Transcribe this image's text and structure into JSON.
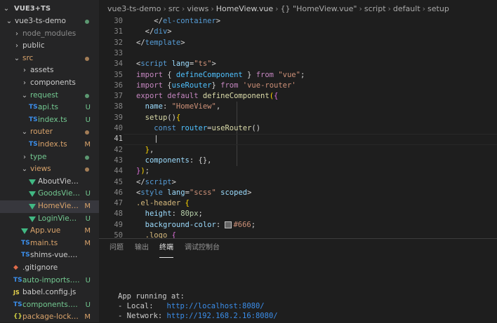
{
  "explorer": {
    "root": "VUE3+TS",
    "items": [
      {
        "label": "vue3-ts-demo",
        "kind": "folder-open",
        "indent": 0,
        "dot": true,
        "color": "#cccccc"
      },
      {
        "label": "node_modules",
        "kind": "folder",
        "indent": 1,
        "color": "#8c8c8c"
      },
      {
        "label": "public",
        "kind": "folder",
        "indent": 1,
        "color": "#cccccc"
      },
      {
        "label": "src",
        "kind": "folder-open",
        "indent": 1,
        "dot": true,
        "color": "#d9a36b"
      },
      {
        "label": "assets",
        "kind": "folder",
        "indent": 2,
        "color": "#cccccc"
      },
      {
        "label": "components",
        "kind": "folder",
        "indent": 2,
        "color": "#cccccc"
      },
      {
        "label": "request",
        "kind": "folder-open",
        "indent": 2,
        "dot": true,
        "color": "#73c991"
      },
      {
        "label": "api.ts",
        "kind": "ts",
        "indent": 3,
        "badge": "U",
        "color": "#73c991"
      },
      {
        "label": "index.ts",
        "kind": "ts",
        "indent": 3,
        "badge": "U",
        "color": "#73c991"
      },
      {
        "label": "router",
        "kind": "folder-open",
        "indent": 2,
        "dot": true,
        "color": "#d9a36b"
      },
      {
        "label": "index.ts",
        "kind": "ts",
        "indent": 3,
        "badge": "M",
        "color": "#d9a36b"
      },
      {
        "label": "type",
        "kind": "folder",
        "indent": 2,
        "dot": true,
        "color": "#73c991"
      },
      {
        "label": "views",
        "kind": "folder-open",
        "indent": 2,
        "dot": true,
        "color": "#d9a36b"
      },
      {
        "label": "AboutView.vue",
        "kind": "vue",
        "indent": 3,
        "color": "#cccccc"
      },
      {
        "label": "GoodsView.vue",
        "kind": "vue",
        "indent": 3,
        "badge": "U",
        "color": "#73c991"
      },
      {
        "label": "HomeView.vue",
        "kind": "vue",
        "indent": 3,
        "badge": "M",
        "color": "#d9a36b",
        "selected": true
      },
      {
        "label": "LoginView.vue",
        "kind": "vue",
        "indent": 3,
        "badge": "U",
        "color": "#73c991"
      },
      {
        "label": "App.vue",
        "kind": "vue",
        "indent": 2,
        "badge": "M",
        "color": "#d9a36b"
      },
      {
        "label": "main.ts",
        "kind": "ts",
        "indent": 2,
        "badge": "M",
        "color": "#d9a36b"
      },
      {
        "label": "shims-vue.d.ts",
        "kind": "ts",
        "indent": 2,
        "color": "#cccccc"
      },
      {
        "label": ".gitignore",
        "kind": "git",
        "indent": 1,
        "color": "#cccccc"
      },
      {
        "label": "auto-imports.d.ts",
        "kind": "ts",
        "indent": 1,
        "badge": "U",
        "color": "#73c991"
      },
      {
        "label": "babel.config.js",
        "kind": "js",
        "indent": 1,
        "color": "#cccccc"
      },
      {
        "label": "components.d.ts",
        "kind": "ts",
        "indent": 1,
        "badge": "U",
        "color": "#73c991"
      },
      {
        "label": "package-lock.json",
        "kind": "json",
        "indent": 1,
        "badge": "M",
        "color": "#d9a36b"
      }
    ]
  },
  "breadcrumb": {
    "parts": [
      "vue3-ts-demo",
      "src",
      "views",
      "HomeView.vue",
      "{} \"HomeView.vue\"",
      "script",
      "default",
      "setup"
    ]
  },
  "code_lines": [
    {
      "n": "30",
      "tokens": [
        [
          "p",
          "    </"
        ],
        [
          "t",
          "el-container"
        ],
        [
          "p",
          ">"
        ]
      ]
    },
    {
      "n": "31",
      "tokens": [
        [
          "p",
          "  </"
        ],
        [
          "t",
          "div"
        ],
        [
          "p",
          ">"
        ]
      ]
    },
    {
      "n": "32",
      "tokens": [
        [
          "p",
          "</"
        ],
        [
          "t",
          "template"
        ],
        [
          "p",
          ">"
        ]
      ]
    },
    {
      "n": "33",
      "tokens": []
    },
    {
      "n": "34",
      "tokens": [
        [
          "p",
          "<"
        ],
        [
          "t",
          "script"
        ],
        [
          "p",
          " "
        ],
        [
          "a",
          "lang"
        ],
        [
          "p",
          "="
        ],
        [
          "s",
          "\"ts\""
        ],
        [
          "p",
          ">"
        ]
      ]
    },
    {
      "n": "35",
      "tokens": [
        [
          "kw",
          "import"
        ],
        [
          "p",
          " { "
        ],
        [
          "v",
          "defineComponent"
        ],
        [
          "p",
          " } "
        ],
        [
          "kw",
          "from"
        ],
        [
          "p",
          " "
        ],
        [
          "s",
          "\"vue\""
        ],
        [
          "p",
          ";"
        ]
      ]
    },
    {
      "n": "36",
      "tokens": [
        [
          "kw",
          "import"
        ],
        [
          "p",
          " {"
        ],
        [
          "v",
          "useRouter"
        ],
        [
          "p",
          "} "
        ],
        [
          "kw",
          "from"
        ],
        [
          "p",
          " "
        ],
        [
          "s",
          "'vue-router'"
        ]
      ]
    },
    {
      "n": "37",
      "tokens": [
        [
          "kw",
          "export"
        ],
        [
          "p",
          " "
        ],
        [
          "kw",
          "default"
        ],
        [
          "p",
          " "
        ],
        [
          "f",
          "defineComponent"
        ],
        [
          "br",
          "("
        ],
        [
          "br2",
          "{"
        ]
      ]
    },
    {
      "n": "38",
      "tokens": [
        [
          "p",
          "  "
        ],
        [
          "a",
          "name"
        ],
        [
          "p",
          ": "
        ],
        [
          "s",
          "\"HomeView\""
        ],
        [
          "p",
          ","
        ]
      ]
    },
    {
      "n": "39",
      "tokens": [
        [
          "p",
          "  "
        ],
        [
          "f",
          "setup"
        ],
        [
          "p",
          "()"
        ],
        [
          "br",
          "{"
        ]
      ]
    },
    {
      "n": "40",
      "tokens": [
        [
          "p",
          "    "
        ],
        [
          "k",
          "const"
        ],
        [
          "p",
          " "
        ],
        [
          "v",
          "router"
        ],
        [
          "p",
          "="
        ],
        [
          "f",
          "useRouter"
        ],
        [
          "p",
          "()"
        ]
      ]
    },
    {
      "n": "41",
      "tokens": [
        [
          "p",
          "    |"
        ]
      ],
      "active": true
    },
    {
      "n": "42",
      "tokens": [
        [
          "p",
          "  "
        ],
        [
          "br",
          "}"
        ],
        [
          "p",
          ","
        ]
      ]
    },
    {
      "n": "43",
      "tokens": [
        [
          "p",
          "  "
        ],
        [
          "a",
          "components"
        ],
        [
          "p",
          ": {},"
        ]
      ]
    },
    {
      "n": "44",
      "tokens": [
        [
          "br2",
          "}"
        ],
        [
          "br",
          ")"
        ],
        [
          "p",
          ";"
        ]
      ]
    },
    {
      "n": "45",
      "tokens": [
        [
          "p",
          "</"
        ],
        [
          "t",
          "script"
        ],
        [
          "p",
          ">"
        ]
      ]
    },
    {
      "n": "46",
      "tokens": [
        [
          "p",
          "<"
        ],
        [
          "t",
          "style"
        ],
        [
          "p",
          " "
        ],
        [
          "a",
          "lang"
        ],
        [
          "p",
          "="
        ],
        [
          "s",
          "\"scss\""
        ],
        [
          "p",
          " "
        ],
        [
          "a",
          "scoped"
        ],
        [
          "p",
          ">"
        ]
      ]
    },
    {
      "n": "47",
      "tokens": [
        [
          "sel",
          ".el-header"
        ],
        [
          "p",
          " "
        ],
        [
          "br",
          "{"
        ]
      ]
    },
    {
      "n": "48",
      "tokens": [
        [
          "p",
          "  "
        ],
        [
          "a",
          "height"
        ],
        [
          "p",
          ": "
        ],
        [
          "n",
          "80px"
        ],
        [
          "p",
          ";"
        ]
      ]
    },
    {
      "n": "49",
      "tokens": [
        [
          "p",
          "  "
        ],
        [
          "a",
          "background-color"
        ],
        [
          "p",
          ": "
        ],
        [
          "swatch",
          ""
        ],
        [
          "s",
          "#666"
        ],
        [
          "p",
          ";"
        ]
      ]
    },
    {
      "n": "50",
      "tokens": [
        [
          "p",
          "  "
        ],
        [
          "sel",
          ".logo"
        ],
        [
          "p",
          " "
        ],
        [
          "br2",
          "{"
        ]
      ]
    }
  ],
  "panel": {
    "tabs": [
      "问题",
      "输出",
      "终端",
      "调试控制台"
    ],
    "active_tab": 2,
    "terminal": {
      "heading": "App running at:",
      "local_label": "- Local:   ",
      "local_url": "http://localhost:8080/",
      "network_label": "- Network: ",
      "network_url": "http://192.168.2.16:8080/"
    }
  }
}
